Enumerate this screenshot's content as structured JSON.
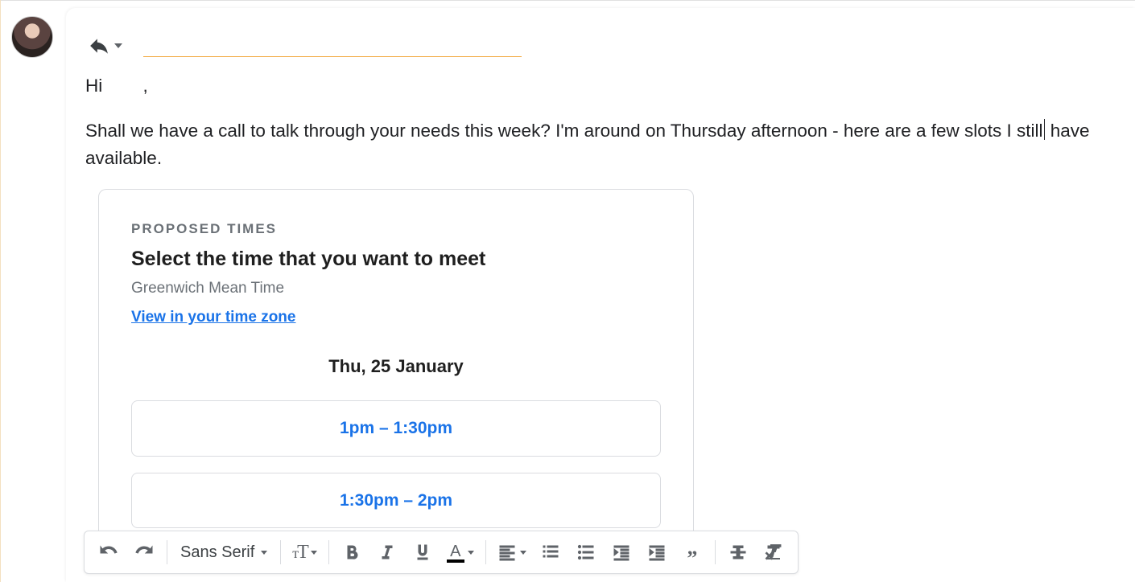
{
  "greeting_prefix": "Hi ",
  "greeting_suffix": ",",
  "body_line_pre": "Shall we have a call to talk through your needs this week? I'm around on Thursday afternoon - here are a few slots I still",
  "body_line_post": " have available.",
  "card": {
    "label": "PROPOSED TIMES",
    "title": "Select the time that you want to meet",
    "timezone": "Greenwich Mean Time",
    "link": "View in your time zone",
    "date": "Thu, 25 January",
    "slots": [
      "1pm – 1:30pm",
      "1:30pm – 2pm"
    ]
  },
  "toolbar": {
    "font": "Sans Serif"
  }
}
